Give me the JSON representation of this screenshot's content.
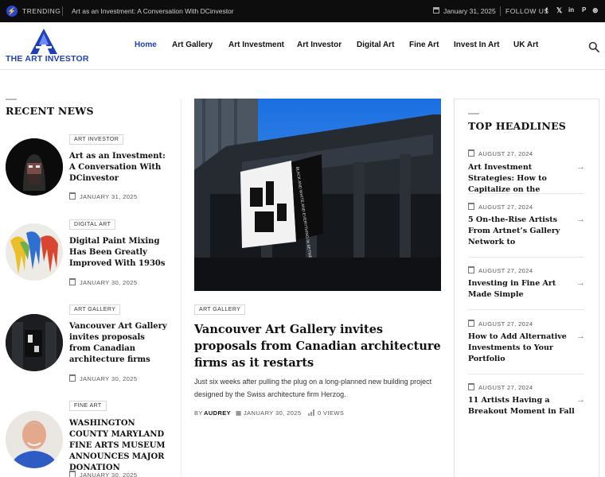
{
  "topbar": {
    "trending_label": "TRENDING",
    "headline": "Art as an Investment: A Conversation With DCinvestor",
    "date": "January 31, 2025",
    "follow_label": "FOLLOW US",
    "social": [
      "f",
      "𝕏",
      "in",
      "P",
      "⊛"
    ]
  },
  "brand": {
    "name": "THE ART INVESTOR",
    "accent": "#1f3fb8"
  },
  "nav": [
    "Home",
    "Art Gallery",
    "Art Investment",
    "Art Investor",
    "Digital Art",
    "Fine Art",
    "Invest In Art",
    "UK Art"
  ],
  "recent": {
    "title": "RECENT NEWS",
    "items": [
      {
        "tag": "ART INVESTOR",
        "title": "Art as an Investment: A Conversation With DCinvestor",
        "date": "JANUARY 31, 2025"
      },
      {
        "tag": "DIGITAL ART",
        "title": "Digital Paint Mixing Has Been Greatly Improved With 1930s",
        "date": "JANUARY 30, 2025"
      },
      {
        "tag": "ART GALLERY",
        "title": "Vancouver Art Gallery invites proposals from Canadian architecture firms",
        "date": "JANUARY 30, 2025"
      },
      {
        "tag": "FINE ART",
        "title": "WASHINGTON COUNTY MARYLAND FINE ARTS MUSEUM ANNOUNCES MAJOR DONATION",
        "date": "JANUARY 30, 2025"
      }
    ]
  },
  "featured": {
    "tag": "ART GALLERY",
    "title": "Vancouver Art Gallery invites proposals from Canadian architecture firms as it restarts",
    "excerpt": "Just six weeks after pulling the plug on a long-planned new building project designed by the Swiss architecture firm Herzog.",
    "by": "BY",
    "author": "AUDREY",
    "date": "JANUARY 30, 2025",
    "views": "0 VIEWS",
    "banner_text": "BLACK AND WHITE AND EVERYTHING IN BETWEEN"
  },
  "top": {
    "title": "TOP HEADLINES",
    "items": [
      {
        "date": "AUGUST 27, 2024",
        "title": "Art Investment Strategies: How to Capitalize on the"
      },
      {
        "date": "AUGUST 27, 2024",
        "title": "5 On-the-Rise Artists From Artnet’s Gallery Network to"
      },
      {
        "date": "AUGUST 27, 2024",
        "title": "Investing in Fine Art Made Simple"
      },
      {
        "date": "AUGUST 27, 2024",
        "title": "How to Add Alternative Investments to Your Portfolio"
      },
      {
        "date": "AUGUST 27, 2024",
        "title": "11 Artists Having a Breakout Moment in Fall"
      }
    ]
  }
}
